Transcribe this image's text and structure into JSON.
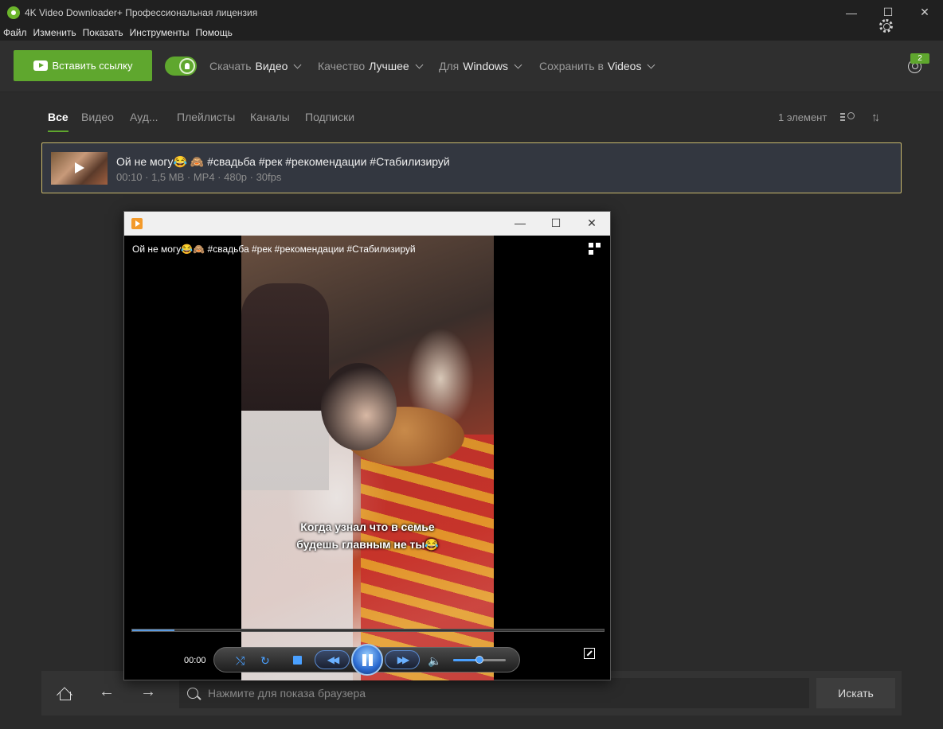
{
  "window": {
    "title": "4K Video Downloader+ Профессиональная лицензия",
    "controls": {
      "minimize": "—",
      "maximize": "☐",
      "close": "✕"
    }
  },
  "menu": [
    "Файл",
    "Изменить",
    "Показать",
    "Инструменты",
    "Помощь"
  ],
  "toolbar": {
    "paste_label": "Вставить ссылку",
    "smart_mode_on": true,
    "download": {
      "label": "Скачать",
      "value": "Видео"
    },
    "quality": {
      "label": "Качество",
      "value": "Лучшее"
    },
    "for": {
      "label": "Для",
      "value": "Windows"
    },
    "save_to": {
      "label": "Сохранить в",
      "value": "Videos"
    },
    "notification_count": "2",
    "accent_color": "#5fa72e"
  },
  "tabs": [
    {
      "label": "Все",
      "active": true
    },
    {
      "label": "Видео",
      "active": false
    },
    {
      "label": "Ауд...",
      "active": false
    },
    {
      "label": "Плейлисты",
      "active": false
    },
    {
      "label": "Каналы",
      "active": false
    },
    {
      "label": "Подписки",
      "active": false
    }
  ],
  "list_count": "1 элемент",
  "downloads": [
    {
      "title": "Ой не могу😂 🙈  #свадьба #рек #рекомендации #Стабилизируй",
      "meta": "00:10 · 1,5 MB · MP4 · 480p · 30fps"
    }
  ],
  "player": {
    "video_title": "Ой не могу😂🙈 #свадьба #рек #рекомендации #Стабилизируй",
    "subtitle_line1": "Когда узнал что в семье",
    "subtitle_line2": "будешь главным не ты😂",
    "time": "00:00",
    "progress": 0.09,
    "volume": 0.5,
    "controls": {
      "rewind": "◀◀",
      "forward": "▶▶",
      "shuffle": "⤭",
      "repeat": "↻",
      "volume": "🔈"
    }
  },
  "browser_bar": {
    "placeholder": "Нажмите для показа браузера",
    "search_label": "Искать",
    "back": "←",
    "forward": "→"
  }
}
